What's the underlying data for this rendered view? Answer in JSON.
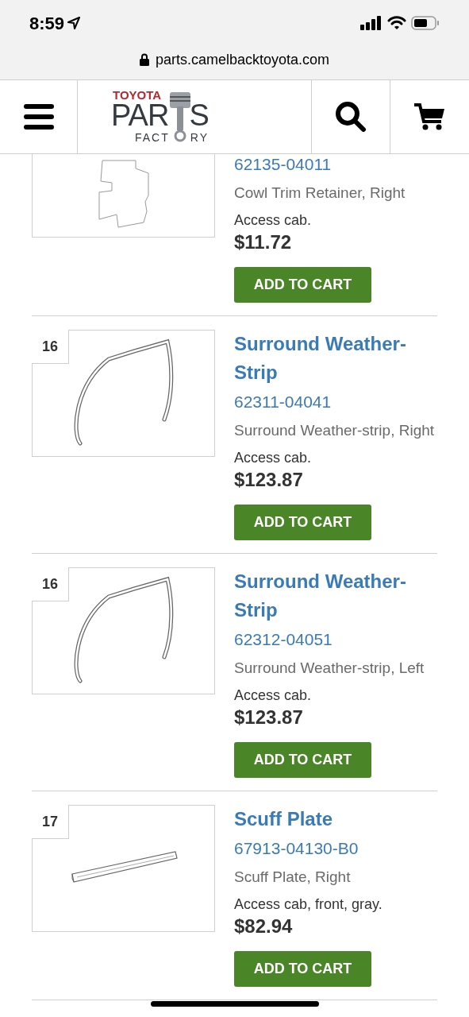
{
  "status_bar": {
    "time": "8:59"
  },
  "url_bar": {
    "url": "parts.camelbacktoyota.com"
  },
  "logo": {
    "brand": "TOYOTA",
    "word_left": "PAR",
    "word_right": "S",
    "sub_left": "FACT",
    "sub_right": "RY"
  },
  "products": [
    {
      "part_number": "62135-04011",
      "description": "Cowl Trim Retainer, Right",
      "fitment": "Access cab.",
      "price": "$11.72",
      "button": "ADD TO CART"
    },
    {
      "ref": "16",
      "title": "Surround Weather-Strip",
      "part_number": "62311-04041",
      "description": "Surround Weather-strip, Right",
      "fitment": "Access cab.",
      "price": "$123.87",
      "button": "ADD TO CART"
    },
    {
      "ref": "16",
      "title": "Surround Weather-Strip",
      "part_number": "62312-04051",
      "description": "Surround Weather-strip, Left",
      "fitment": "Access cab.",
      "price": "$123.87",
      "button": "ADD TO CART"
    },
    {
      "ref": "17",
      "title": "Scuff Plate",
      "part_number": "67913-04130-B0",
      "description": "Scuff Plate, Right",
      "fitment": "Access cab, front, gray.",
      "price": "$82.94",
      "button": "ADD TO CART"
    }
  ]
}
